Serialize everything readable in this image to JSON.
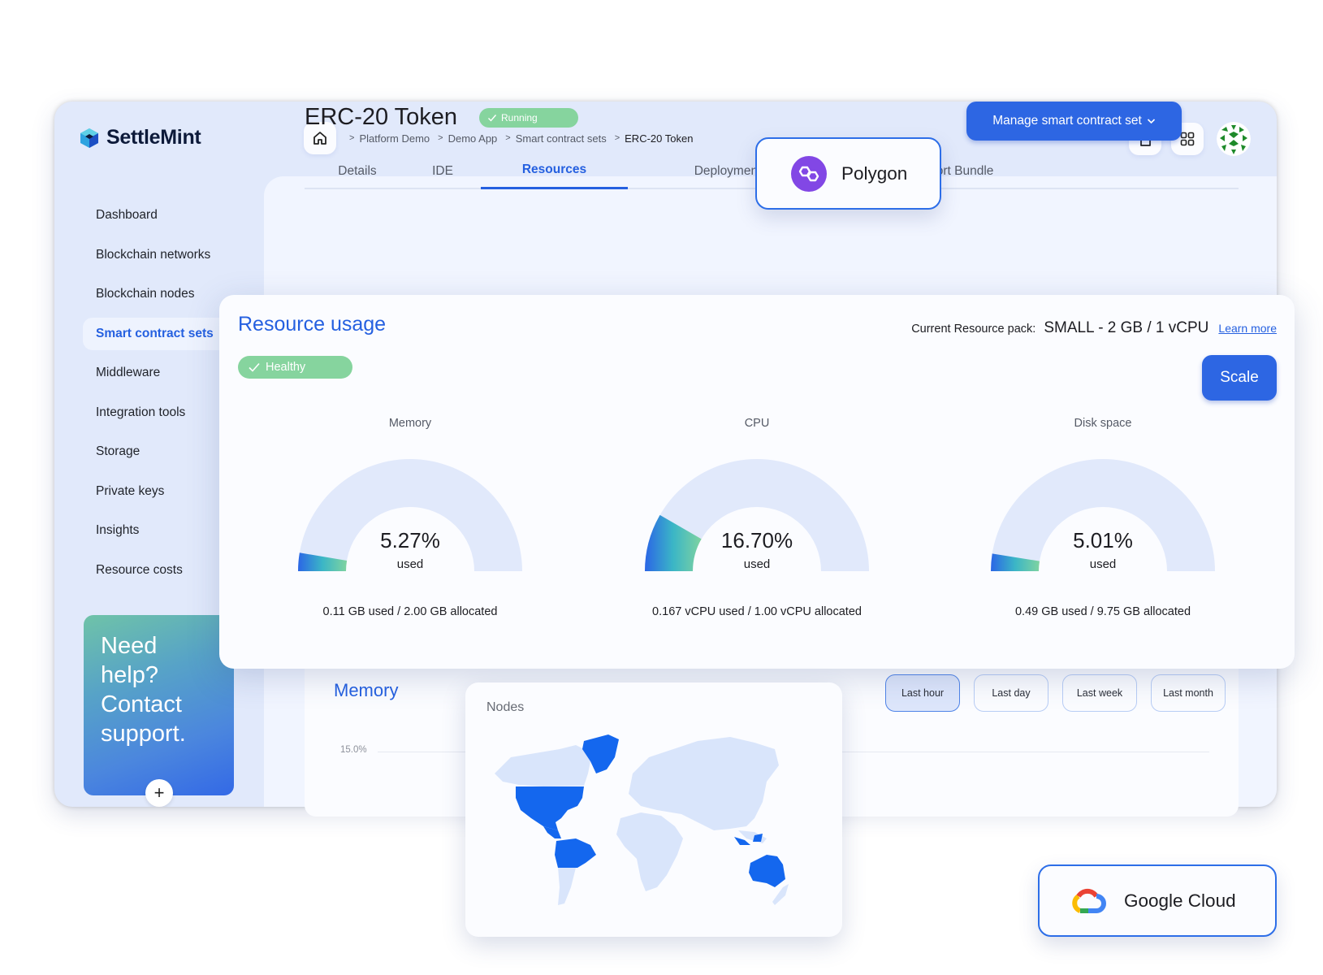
{
  "brand": {
    "name": "SettleMint"
  },
  "breadcrumb": {
    "home_icon": "home-icon",
    "items": [
      "Platform Demo",
      "Demo App",
      "Smart contract sets",
      "ERC-20 Token"
    ],
    "separator": ">"
  },
  "top_icons": [
    "document-icon",
    "apps-grid-icon",
    "user-avatar"
  ],
  "sidebar": {
    "items": [
      {
        "label": "Dashboard",
        "active": false
      },
      {
        "label": "Blockchain networks",
        "active": false
      },
      {
        "label": "Blockchain nodes",
        "active": false
      },
      {
        "label": "Smart contract sets",
        "active": true
      },
      {
        "label": "Middleware",
        "active": false
      },
      {
        "label": "Integration tools",
        "active": false
      },
      {
        "label": "Storage",
        "active": false
      },
      {
        "label": "Private keys",
        "active": false
      },
      {
        "label": "Insights",
        "active": false
      },
      {
        "label": "Resource costs",
        "active": false
      }
    ],
    "help_card": {
      "text": "Need help? Contact support.",
      "button": "+"
    }
  },
  "page": {
    "title": "ERC-20 Token",
    "status": "Running",
    "manage_button": "Manage smart contract set",
    "tabs": [
      {
        "label": "Details",
        "active": false
      },
      {
        "label": "IDE",
        "active": false
      },
      {
        "label": "Resources",
        "active": true
      },
      {
        "label": "Deployment Logs",
        "active": false
      },
      {
        "label": "Support Bundle",
        "active": false
      }
    ]
  },
  "network_badge": {
    "label": "Polygon",
    "color": "#8247e5"
  },
  "resource_usage": {
    "title": "Resource usage",
    "health": "Healthy",
    "pack_label": "Current Resource pack:",
    "pack_value": "SMALL -  2 GB / 1 vCPU",
    "learn_more": "Learn more",
    "scale_button": "Scale",
    "gauges": [
      {
        "label": "Memory",
        "percent_text": "5.27%",
        "percent": 5.27,
        "used_label": "used",
        "detail": "0.11 GB used / 2.00 GB allocated"
      },
      {
        "label": "CPU",
        "percent_text": "16.70%",
        "percent": 16.7,
        "used_label": "used",
        "detail": "0.167 vCPU used / 1.00 vCPU allocated"
      },
      {
        "label": "Disk space",
        "percent_text": "5.01%",
        "percent": 5.01,
        "used_label": "used",
        "detail": "0.49 GB used / 9.75 GB allocated"
      }
    ]
  },
  "memory_chart": {
    "title": "Memory",
    "y_tick": "15.0%",
    "ranges": [
      {
        "label": "Last hour",
        "active": true
      },
      {
        "label": "Last day",
        "active": false
      },
      {
        "label": "Last week",
        "active": false
      },
      {
        "label": "Last month",
        "active": false
      }
    ]
  },
  "nodes": {
    "title": "Nodes",
    "highlighted_regions": [
      "North America",
      "Greenland",
      "Central America",
      "South America (north)",
      "Indonesia",
      "Australia"
    ]
  },
  "cloud_badge": {
    "label": "Google Cloud"
  },
  "colors": {
    "accent": "#2560e0",
    "button": "#2d66e3",
    "success": "#86d49e",
    "map_highlight": "#1467ee",
    "map_base": "#d9e5fb"
  }
}
